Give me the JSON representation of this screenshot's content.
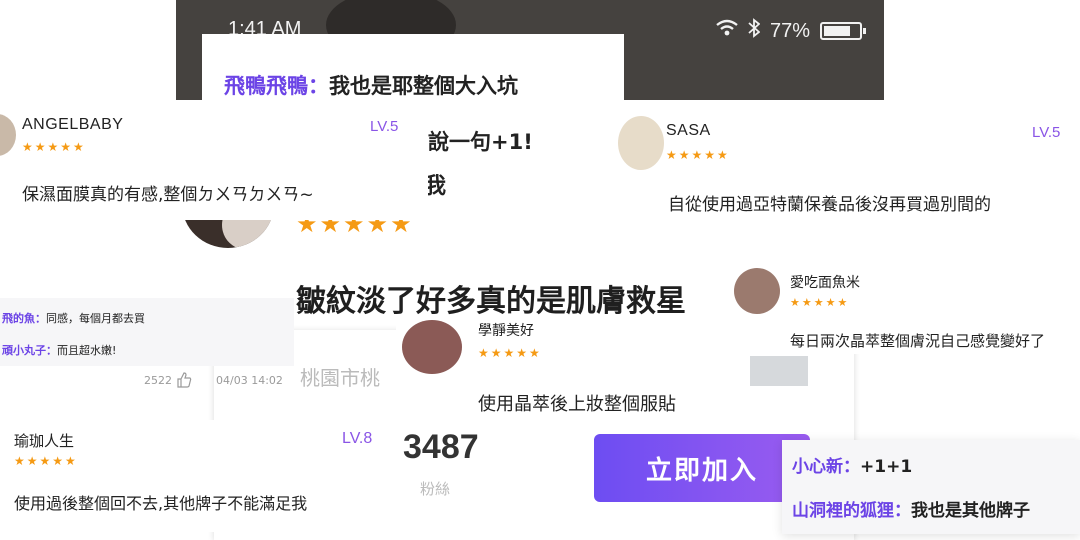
{
  "phone": {
    "time": "1:41 AM",
    "battery": "77%"
  },
  "comment_top": {
    "user": "飛鴨飛鴨：",
    "text": "我也是耶整個大入坑",
    "line2": "說一句+1!",
    "line3": "我"
  },
  "reviews": {
    "angelbaby": {
      "name": "ANGELBABY",
      "level": "LV.5",
      "stars": "★★★★★",
      "text": "保濕面膜真的有感,整個ㄉㄨㄢㄉㄨㄢ~"
    },
    "sasa": {
      "name": "SASA",
      "level": "LV.5",
      "stars": "★★★★★",
      "text": "自從使用過亞特蘭保養品後沒再買過別間的"
    },
    "aichi": {
      "name": "愛吃面魚米",
      "stars": "★★★★★",
      "text": "每日兩次晶萃整個膚況自己感覺變好了"
    },
    "xuejing": {
      "name": "學靜美好",
      "stars": "★★★★★",
      "text": "使用晶萃後上妝整個服貼"
    },
    "yujia": {
      "name": "瑜珈人生",
      "level": "LV.8",
      "stars": "★★★★★",
      "text": "使用過後整個回不去,其他牌子不能滿足我"
    }
  },
  "big_stars": "★★★★★",
  "headline": "皺紋淡了好多真的是肌膚救星",
  "mini_chat": {
    "line1_user": "飛的魚：",
    "line1_text": "同感，每個月都去買",
    "line2_user": "頑小丸子：",
    "line2_text": "而且超水嫩!",
    "likes": "2522",
    "date": "04/03 14:02"
  },
  "panel": {
    "city": "桃園市桃",
    "fans_count": "3487",
    "fans_label": "粉絲",
    "join_button": "立即加入"
  },
  "chat_right": {
    "line1_user": "小心新：",
    "line1_text": "+1+1",
    "line2_user": "山洞裡的狐狸：",
    "line2_text": "我也是其他牌子"
  },
  "colors": {
    "accent": "#6c44e6",
    "star": "#f59a14",
    "phone_bar": "#45423f"
  }
}
